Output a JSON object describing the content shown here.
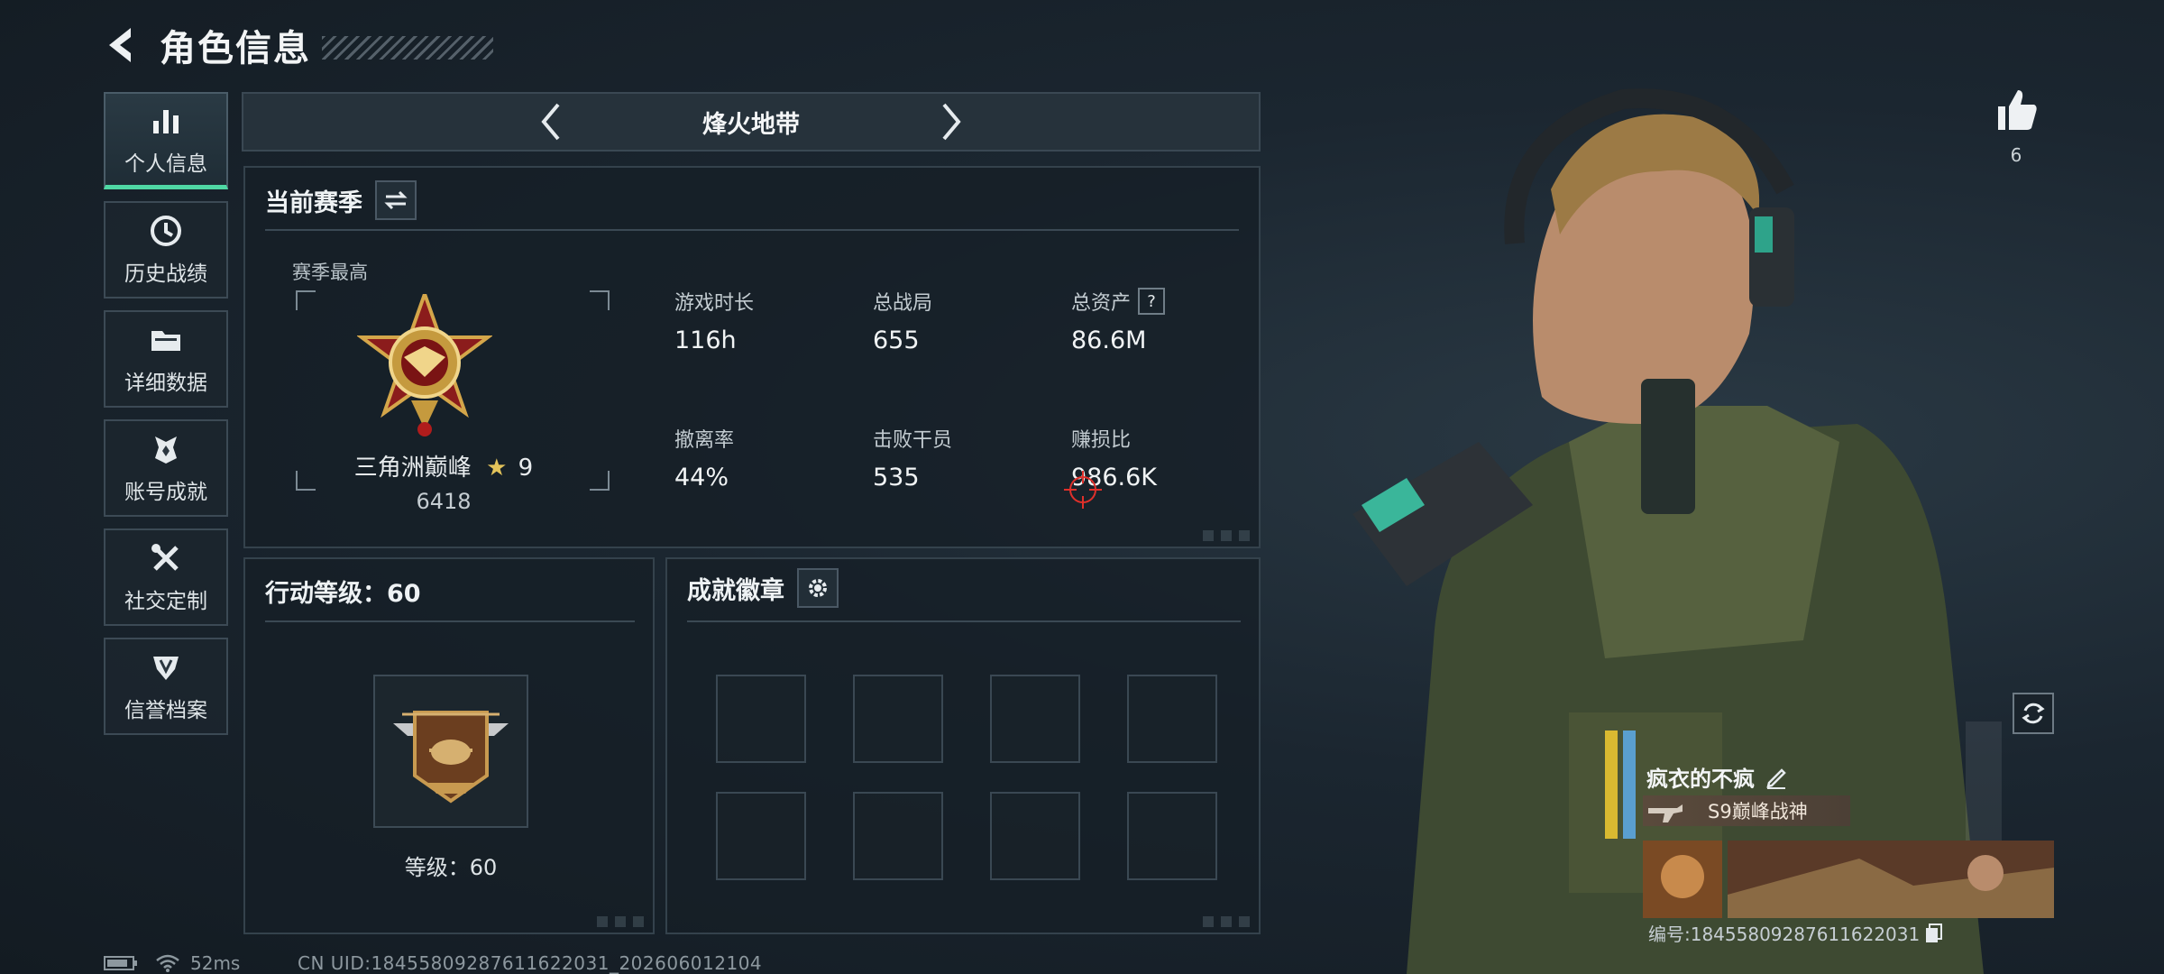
{
  "header": {
    "title": "角色信息"
  },
  "sidebar": {
    "items": [
      {
        "label": "个人信息",
        "icon": "bar-chart-icon",
        "active": true
      },
      {
        "label": "历史战绩",
        "icon": "history-clock-icon",
        "active": false
      },
      {
        "label": "详细数据",
        "icon": "folder-icon",
        "active": false
      },
      {
        "label": "账号成就",
        "icon": "achievement-icon",
        "active": false
      },
      {
        "label": "社交定制",
        "icon": "tools-icon",
        "active": false
      },
      {
        "label": "信誉档案",
        "icon": "reputation-icon",
        "active": false
      }
    ]
  },
  "mode": {
    "title": "烽火地带"
  },
  "season": {
    "title": "当前赛季",
    "subtitle": "赛季最高",
    "rank_name": "三角洲巅峰",
    "rank_star_icon": "★",
    "rank_stars": "9",
    "rank_score": "6418",
    "stats": [
      {
        "label": "游戏时长",
        "value": "116h"
      },
      {
        "label": "总战局",
        "value": "655"
      },
      {
        "label": "总资产",
        "value": "86.6M",
        "help": "?"
      },
      {
        "label": "撤离率",
        "value": "44%"
      },
      {
        "label": "击败干员",
        "value": "535"
      },
      {
        "label": "赚损比",
        "value": "986.6K"
      }
    ]
  },
  "level": {
    "title": "行动等级：60",
    "label": "等级：60"
  },
  "badges": {
    "title": "成就徽章",
    "slots": 8
  },
  "status": {
    "ping": "52ms",
    "uid_line": "CN UID:18455809287611622031_202606012104"
  },
  "profile": {
    "likes": "6",
    "name": "疯衣的不疯",
    "title_chip": "S9巅峰战神",
    "id_line": "编号:18455809287611622031"
  },
  "colors": {
    "accent": "#4fd8a4",
    "panel_border": "#34424c",
    "alert": "#e0302a"
  }
}
